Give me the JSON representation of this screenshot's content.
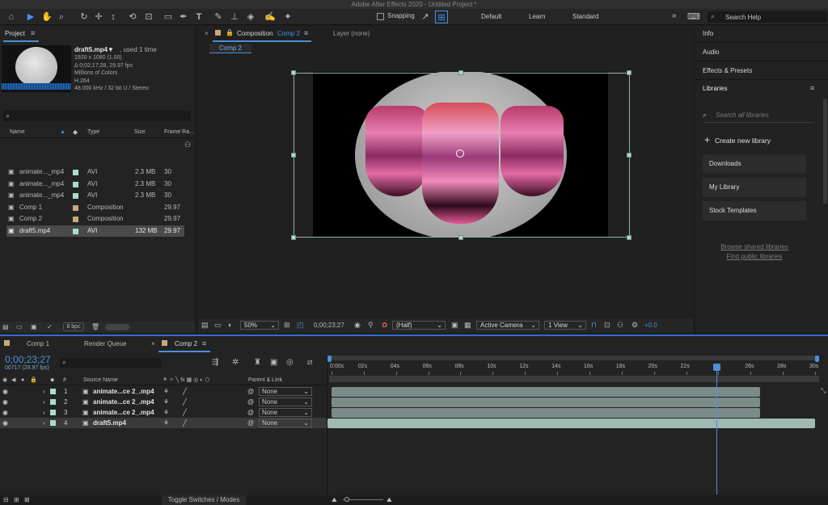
{
  "app": {
    "title": "Adobe After Effects 2020 - Untitled Project *"
  },
  "toolbar": {
    "snapping_label": "Snapping",
    "workspaces": [
      "Default",
      "Learn",
      "Standard"
    ],
    "more": "»",
    "search_help": "Search Help"
  },
  "project": {
    "title": "Project",
    "menu": "≡",
    "file": {
      "name": "draft5.mp4▼",
      "used": ", used 1 time",
      "lines": [
        "1920 x 1080 (1.00)",
        "Δ 0;02;17;28, 29.97 fps",
        "Millions of Colors",
        "H.264",
        "48.000 kHz / 32 bit U / Stereo"
      ]
    },
    "search_placeholder": "⌕",
    "columns": {
      "name": "Name",
      "type": "Type",
      "size": "Size",
      "frame_rate": "Frame Ra..."
    },
    "items": [
      {
        "name": "animate..._mp4",
        "type": "AVI",
        "size": "2.3 MB",
        "fps": "30",
        "color": "#a9ddd0"
      },
      {
        "name": "animate..._mp4",
        "type": "AVI",
        "size": "2.3 MB",
        "fps": "30",
        "color": "#a9ddd0"
      },
      {
        "name": "animate..._mp4",
        "type": "AVI",
        "size": "2.3 MB",
        "fps": "30",
        "color": "#a9ddd0"
      },
      {
        "name": "Comp 1",
        "type": "Composition",
        "size": "",
        "fps": "29.97",
        "color": "#c9a87a"
      },
      {
        "name": "Comp 2",
        "type": "Composition",
        "size": "",
        "fps": "29.97",
        "color": "#c9a87a"
      },
      {
        "name": "draft5.mp4",
        "type": "AVI",
        "size": "132 MB",
        "fps": "29.97",
        "color": "#a9ddd0"
      }
    ],
    "bpc": "8 bpc"
  },
  "composition": {
    "tab_prefix": "Composition",
    "tab_name": "Comp 2",
    "menu": "≡",
    "layer_tab": "Layer (none)",
    "breadcrumb": "Comp 2",
    "footer": {
      "zoom": "50%",
      "timecode": "0;00;23;27",
      "resolution": "(Half)",
      "camera": "Active Camera",
      "view": "1 View",
      "exposure": "+0.0"
    }
  },
  "right_panel": {
    "info": "Info",
    "audio": "Audio",
    "effects": "Effects & Presets",
    "libraries": "Libraries",
    "menu": "≡",
    "search_placeholder": "Search all libraries",
    "create_library": "Create new library",
    "library_items": [
      "Downloads",
      "My Library",
      "Stock Templates"
    ],
    "browse_link": "Browse shared libraries",
    "find_link": "Find public libraries"
  },
  "timeline": {
    "tabs": [
      "Comp 1",
      "Render Queue",
      "Comp 2"
    ],
    "close": "×",
    "menu": "≡",
    "timecode": "0;00;23;27",
    "frames": "00717 (29.97 fps)",
    "search_placeholder": "⌕",
    "columns": {
      "num": "#",
      "source_name": "Source Name",
      "parent": "Parent & Link"
    },
    "layers": [
      {
        "num": "1",
        "name": "animate...ce 2_.mp4",
        "parent": "None"
      },
      {
        "num": "2",
        "name": "animate...ce 2_.mp4",
        "parent": "None"
      },
      {
        "num": "3",
        "name": "animate...ce 2_.mp4",
        "parent": "None"
      },
      {
        "num": "4",
        "name": "draft5.mp4",
        "parent": "None"
      }
    ],
    "ruler": [
      "0:00s",
      "02s",
      "04s",
      "06s",
      "08s",
      "10s",
      "12s",
      "14s",
      "16s",
      "18s",
      "20s",
      "22s",
      "",
      "26s",
      "28s",
      "30s"
    ],
    "playhead_seconds": 23.9,
    "duration_seconds": 30,
    "layer_bars": [
      {
        "start": 0,
        "end": 26.6
      },
      {
        "start": 0,
        "end": 26.6
      },
      {
        "start": 0,
        "end": 26.6
      },
      {
        "start": 0,
        "end": 30
      }
    ],
    "toggle_label": "Toggle Switches / Modes"
  }
}
